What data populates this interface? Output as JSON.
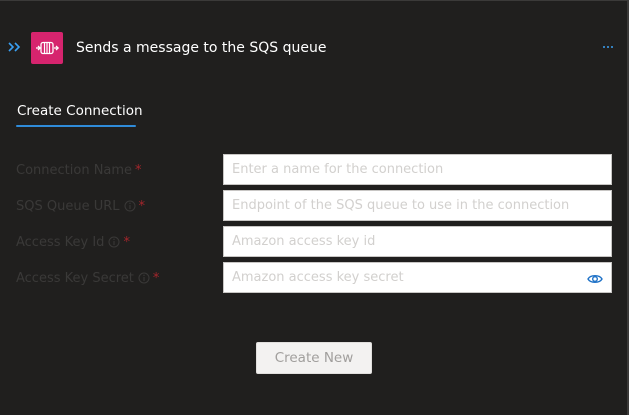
{
  "header": {
    "title": "Sends a message to the SQS queue",
    "expand_icon": "double-chevron-right-icon",
    "service_icon": "amazon-sqs-icon",
    "more_icon": "ellipsis-icon",
    "service_color": "#d6246e",
    "accent_color": "#3aa0f3"
  },
  "tabs": [
    {
      "label": "Create Connection",
      "selected": true
    }
  ],
  "form": {
    "fields": [
      {
        "label": "Connection Name",
        "required": true,
        "info": false,
        "placeholder": "Enter a name for the connection",
        "value": ""
      },
      {
        "label": "SQS Queue URL",
        "required": true,
        "info": true,
        "placeholder": "Endpoint of the SQS queue to use in the connection",
        "value": ""
      },
      {
        "label": "Access Key Id",
        "required": true,
        "info": true,
        "placeholder": "Amazon access key id",
        "value": ""
      },
      {
        "label": "Access Key Secret",
        "required": true,
        "info": true,
        "placeholder": "Amazon access key secret",
        "value": "",
        "reveal_icon": "eye-icon"
      }
    ],
    "required_marker": "*"
  },
  "actions": {
    "create_label": "Create New",
    "create_enabled": false
  }
}
